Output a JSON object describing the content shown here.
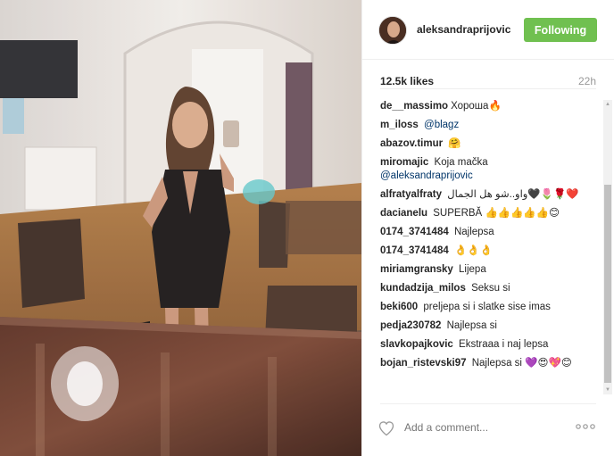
{
  "header": {
    "username": "aleksandraprijovic",
    "follow_label": "Following"
  },
  "stats": {
    "likes": "12.5k likes",
    "time": "22h"
  },
  "comments": [
    {
      "author": "de__massimo",
      "text": "Хороша",
      "emoji": "🔥"
    },
    {
      "author": "m_iloss",
      "mention": "@blagz"
    },
    {
      "author": "abazov.timur",
      "emoji": "🤗"
    },
    {
      "author": "miromajic",
      "text": "Koja mačka",
      "mention": "@aleksandraprijovic"
    },
    {
      "author": "alfratyalfraty",
      "text": "واو..شو هل الجمال",
      "emoji": "🖤🌷🌹❤️"
    },
    {
      "author": "dacianelu",
      "text": "SUPERBĂ",
      "emoji": "👍👍👍👍👍😊"
    },
    {
      "author": "0174_3741484",
      "text": "Najlepsa"
    },
    {
      "author": "0174_3741484",
      "emoji": "👌👌👌"
    },
    {
      "author": "miriamgransky",
      "text": "Lijepa"
    },
    {
      "author": "kundadzija_milos",
      "text": "Seksu si"
    },
    {
      "author": "beki600",
      "text": "preljepa si i slatke sise imas"
    },
    {
      "author": "pedja230782",
      "text": "Najlepsa si"
    },
    {
      "author": "slavkopajkovic",
      "text": "Ekstraaa i naj lepsa"
    },
    {
      "author": "bojan_ristevski97",
      "text": "Najlepsa si",
      "emoji": "💜😍💖😊"
    }
  ],
  "comment_input": {
    "placeholder": "Add a comment..."
  },
  "icons": {
    "like": "heart-outline-icon",
    "more": "more-options-icon"
  },
  "colors": {
    "follow_bg": "#70c050",
    "mention": "#003569",
    "text": "#262626",
    "muted": "#999999"
  }
}
